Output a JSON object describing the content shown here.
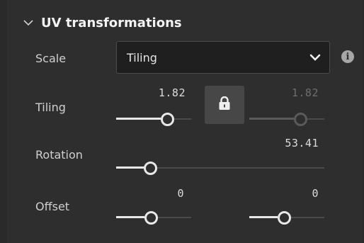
{
  "section": {
    "title": "UV transformations",
    "expanded": true
  },
  "scale": {
    "label": "Scale",
    "selected": "Tiling",
    "info_icon": "info-circle-icon"
  },
  "tiling": {
    "label": "Tiling",
    "u_value": "1.82",
    "v_value": "1.82",
    "locked": true,
    "u_level": 0.6,
    "v_level": 0.6
  },
  "rotation": {
    "label": "Rotation",
    "value": "53.41",
    "level": 0.15
  },
  "offset": {
    "label": "Offset",
    "u_value": "0",
    "v_value": "0",
    "u_level": 0.5,
    "v_level": 0.5
  },
  "colors": {
    "panel_bg": "#2e2e2e",
    "accent": "#e8e8e8",
    "muted": "#5a5a5a"
  }
}
